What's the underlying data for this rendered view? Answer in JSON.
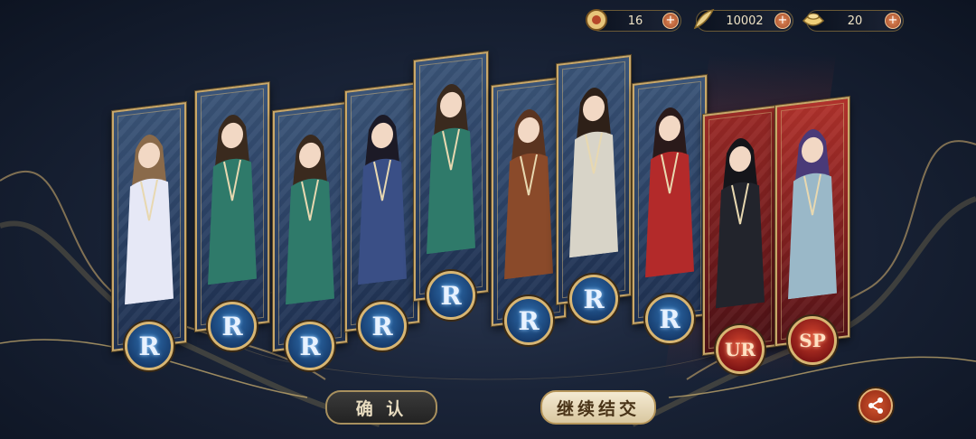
{
  "currencies": [
    {
      "icon": "coin-icon",
      "value": "16"
    },
    {
      "icon": "feather-icon",
      "value": "10002"
    },
    {
      "icon": "ingot-icon",
      "value": "20"
    }
  ],
  "cards": [
    {
      "rarity": "R",
      "character": "girl-white-dress"
    },
    {
      "rarity": "R",
      "character": "bearded-man-fan"
    },
    {
      "rarity": "R",
      "character": "bearded-man-fan"
    },
    {
      "rarity": "R",
      "character": "long-hair-swordsman"
    },
    {
      "rarity": "R",
      "character": "bearded-man-fan"
    },
    {
      "rarity": "R",
      "character": "warrior-scarf"
    },
    {
      "rarity": "R",
      "character": "smiling-scholar"
    },
    {
      "rarity": "R",
      "character": "girl-red-armor"
    },
    {
      "rarity": "UR",
      "character": "black-robe-lord"
    },
    {
      "rarity": "SP",
      "character": "purple-hair-noble"
    }
  ],
  "buttons": {
    "confirm": "确 认",
    "continue": "继续结交"
  },
  "colors": {
    "card_r": "#2a4063",
    "card_ur": "#7e1f1f",
    "gold_border": "#c9a86a"
  }
}
